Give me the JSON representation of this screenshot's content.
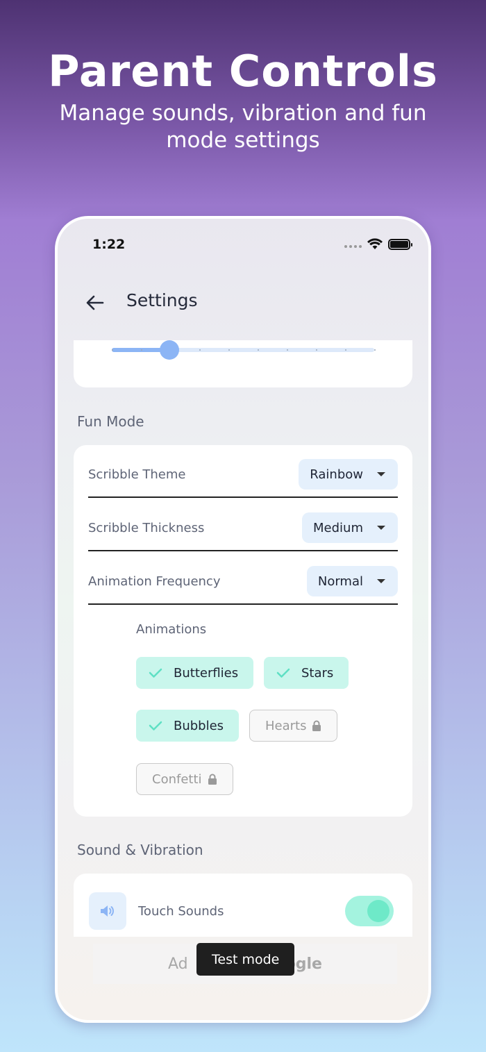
{
  "hero": {
    "title": "Parent Controls",
    "subtitle": "Manage sounds, vibration and fun mode settings"
  },
  "status_bar": {
    "time": "1:22",
    "icons": [
      "cellular-dots-icon",
      "wifi-icon",
      "battery-icon"
    ]
  },
  "app_bar": {
    "back_icon": "arrow-left-icon",
    "title": "Settings"
  },
  "top_slider": {
    "value_fraction": 0.22,
    "steps": 10
  },
  "fun_mode": {
    "section_title": "Fun Mode",
    "rows": [
      {
        "label": "Scribble Theme",
        "value": "Rainbow"
      },
      {
        "label": "Scribble Thickness",
        "value": "Medium"
      },
      {
        "label": "Animation Frequency",
        "value": "Normal"
      }
    ],
    "animations_label": "Animations",
    "chips": [
      {
        "label": "Butterflies",
        "selected": true,
        "locked": false
      },
      {
        "label": "Stars",
        "selected": true,
        "locked": false
      },
      {
        "label": "Bubbles",
        "selected": true,
        "locked": false
      },
      {
        "label": "Hearts",
        "selected": false,
        "locked": true
      },
      {
        "label": "Confetti",
        "selected": false,
        "locked": true
      }
    ]
  },
  "sound_vibration": {
    "section_title": "Sound & Vibration",
    "items": [
      {
        "label": "Touch Sounds",
        "icon": "speaker-icon",
        "enabled": true
      }
    ]
  },
  "ad": {
    "text_left": "Ad",
    "text_right": "ogle"
  },
  "toast": {
    "text": "Test mode"
  },
  "colors": {
    "accent_blue": "#8cb5f5",
    "chip_selected": "#c9f6ec",
    "check_color": "#5ee0c4",
    "toggle_on": "#6ee9c8"
  }
}
